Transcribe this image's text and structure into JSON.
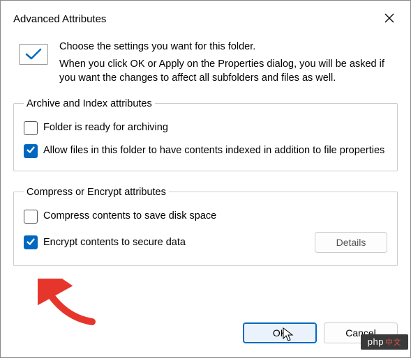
{
  "dialog": {
    "title": "Advanced Attributes",
    "intro_heading": "Choose the settings you want for this folder.",
    "intro_body": "When you click OK or Apply on the Properties dialog, you will be asked if you want the changes to affect all subfolders and files as well."
  },
  "group_archive": {
    "legend": "Archive and Index attributes",
    "items": [
      {
        "label": "Folder is ready for archiving",
        "checked": false
      },
      {
        "label": "Allow files in this folder to have contents indexed in addition to file properties",
        "checked": true
      }
    ]
  },
  "group_encrypt": {
    "legend": "Compress or Encrypt attributes",
    "items": [
      {
        "label": "Compress contents to save disk space",
        "checked": false
      },
      {
        "label": "Encrypt contents to secure data",
        "checked": true
      }
    ],
    "details_label": "Details"
  },
  "buttons": {
    "ok": "OK",
    "cancel": "Cancel"
  },
  "watermark": "php"
}
